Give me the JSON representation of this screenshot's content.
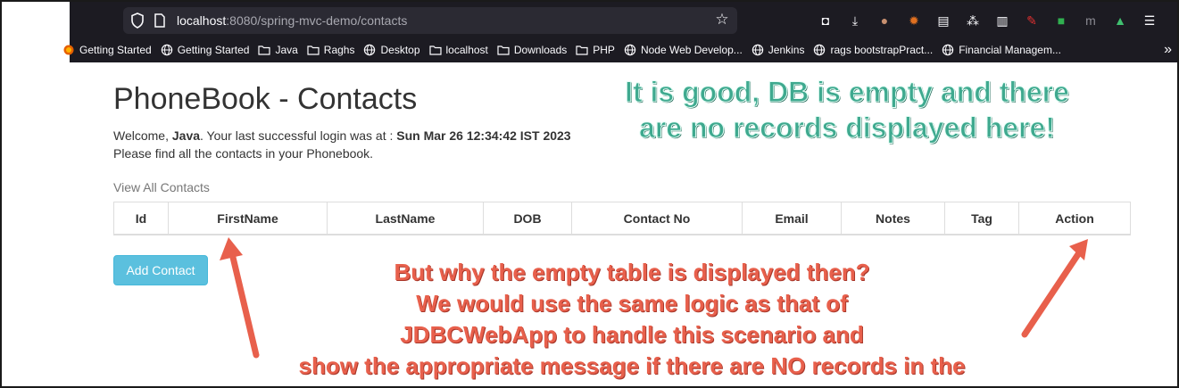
{
  "browser": {
    "url_host": "localhost",
    "url_rest": ":8080/spring-mvc-demo/contacts",
    "toolbar_icons": [
      "pocket-icon",
      "download-icon",
      "profile-icon",
      "extension-sun-icon",
      "clipboard-icon",
      "extension-bubbles-icon",
      "reader-icon",
      "extension-wand-icon",
      "extension-green-icon",
      "extension-m-icon",
      "extension-upload-icon",
      "menu-icon"
    ],
    "bookmarks": [
      {
        "label": "Getting Started",
        "icon": "firefox-icon"
      },
      {
        "label": "Getting Started",
        "icon": "globe-icon"
      },
      {
        "label": "Java",
        "icon": "folder-icon"
      },
      {
        "label": "Raghs",
        "icon": "folder-icon"
      },
      {
        "label": "Desktop",
        "icon": "globe-icon"
      },
      {
        "label": "localhost",
        "icon": "folder-icon"
      },
      {
        "label": "Downloads",
        "icon": "folder-icon"
      },
      {
        "label": "PHP",
        "icon": "folder-icon"
      },
      {
        "label": "Node Web Develop...",
        "icon": "globe-icon"
      },
      {
        "label": "Jenkins",
        "icon": "globe-icon"
      },
      {
        "label": "rags bootstrapPract...",
        "icon": "globe-icon"
      },
      {
        "label": "Financial Managem...",
        "icon": "globe-icon"
      }
    ],
    "bookmarks_more": "»"
  },
  "page": {
    "title": "PhoneBook - Contacts",
    "welcome_prefix": "Welcome, ",
    "welcome_user": "Java",
    "welcome_mid": ". Your last successful login was at : ",
    "welcome_time": "Sun Mar 26 12:34:42 IST 2023",
    "find_text": "Please find all the contacts in your Phonebook.",
    "view_all": "View All Contacts",
    "table_headers": [
      "Id",
      "FirstName",
      "LastName",
      "DOB",
      "Contact No",
      "Email",
      "Notes",
      "Tag",
      "Action"
    ],
    "add_button": "Add Contact"
  },
  "annotations": {
    "green_line1": "It is good, DB is empty and there",
    "green_line2": "are no records displayed here!",
    "red_lines": [
      "But why the empty table is displayed then?",
      "We would use the same logic as that of",
      "JDBCWebApp to handle this scenario and",
      "show the appropriate message if there are NO records in the"
    ]
  },
  "colors": {
    "chrome_bg": "#1c1b22",
    "urlbar_bg": "#2b2a33",
    "button_info": "#5bc0de",
    "annotation_green": "#3fa98f",
    "annotation_red": "#e8604c"
  }
}
